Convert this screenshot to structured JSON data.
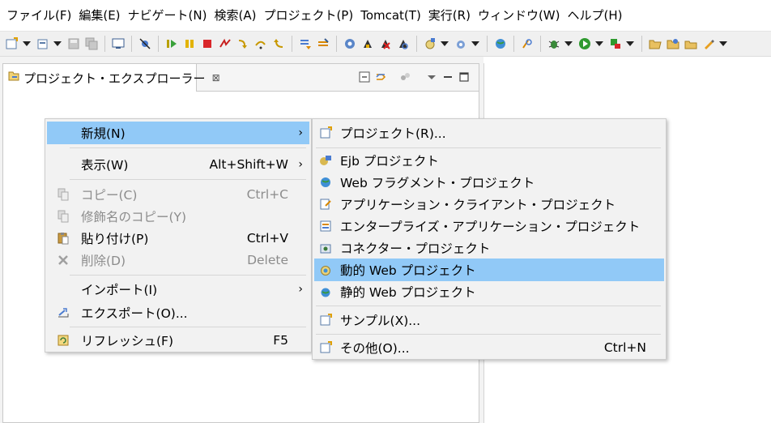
{
  "menubar": {
    "items": [
      "ファイル(F)",
      "編集(E)",
      "ナビゲート(N)",
      "検索(A)",
      "プロジェクト(P)",
      "Tomcat(T)",
      "実行(R)",
      "ウィンドウ(W)",
      "ヘルプ(H)"
    ]
  },
  "explorer": {
    "title": "プロジェクト・エクスプローラー",
    "close": "⊠"
  },
  "context_menu": {
    "items": [
      {
        "label": "新規(N)",
        "accel": "",
        "submenu": true,
        "enabled": true,
        "highlighted": true
      },
      {
        "label": "表示(W)",
        "accel": "Alt+Shift+W",
        "submenu": true,
        "enabled": true
      },
      {
        "label": "コピー(C)",
        "accel": "Ctrl+C",
        "enabled": false
      },
      {
        "label": "修飾名のコピー(Y)",
        "accel": "",
        "enabled": false
      },
      {
        "label": "貼り付け(P)",
        "accel": "Ctrl+V",
        "enabled": true
      },
      {
        "label": "削除(D)",
        "accel": "Delete",
        "enabled": false
      },
      {
        "label": "インポート(I)",
        "accel": "",
        "submenu": true,
        "enabled": true
      },
      {
        "label": "エクスポート(O)...",
        "accel": "",
        "enabled": true
      },
      {
        "label": "リフレッシュ(F)",
        "accel": "F5",
        "enabled": true
      }
    ]
  },
  "submenu": {
    "items": [
      {
        "label": "プロジェクト(R)...",
        "accel": ""
      },
      {
        "label": "Ejb プロジェクト",
        "accel": ""
      },
      {
        "label": "Web フラグメント・プロジェクト",
        "accel": ""
      },
      {
        "label": "アプリケーション・クライアント・プロジェクト",
        "accel": ""
      },
      {
        "label": "エンタープライズ・アプリケーション・プロジェクト",
        "accel": ""
      },
      {
        "label": "コネクター・プロジェクト",
        "accel": ""
      },
      {
        "label": "動的 Web プロジェクト",
        "accel": "",
        "highlighted": true
      },
      {
        "label": "静的 Web プロジェクト",
        "accel": ""
      },
      {
        "label": "サンプル(X)...",
        "accel": ""
      },
      {
        "label": "その他(O)...",
        "accel": "Ctrl+N"
      }
    ]
  },
  "icons": {
    "toolbar": [
      "new-wizard-icon",
      "new-server-icon",
      "save-icon",
      "save-all-icon",
      "console-icon",
      "skip-breakpoints-icon",
      "resume-icon",
      "suspend-icon",
      "terminate-icon",
      "disconnect-icon",
      "step-into-icon",
      "step-over-icon",
      "step-return-icon",
      "open-type-icon",
      "open-task-icon",
      "settings-gear-icon",
      "tomcat-start-icon",
      "tomcat-stop-icon",
      "tomcat-restart-icon",
      "new-java-project-icon",
      "new-package-icon",
      "globe-icon",
      "search-icon",
      "debug-icon",
      "run-icon",
      "external-tools-icon",
      "folder-open-icon",
      "folder-icon",
      "folder-new-icon",
      "pen-icon"
    ]
  },
  "colors": {
    "highlight": "#91c9f7",
    "menu_bg": "#f2f2f2",
    "disabled_text": "#8c8c8c"
  }
}
